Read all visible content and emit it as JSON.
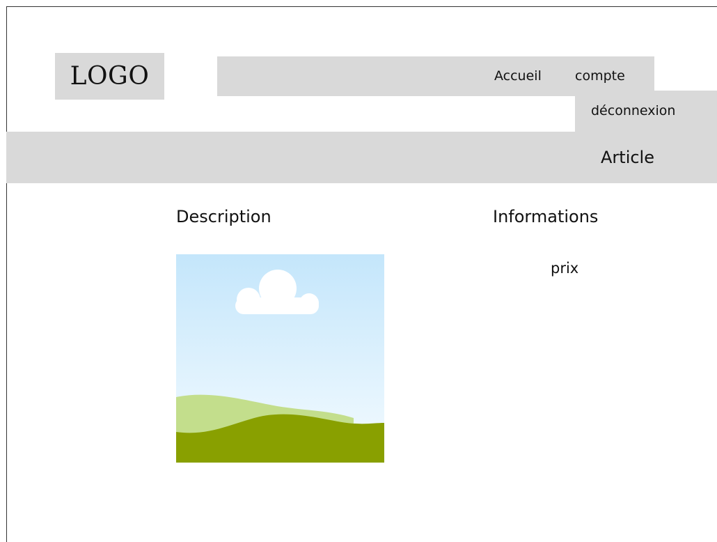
{
  "header": {
    "logo_text": "LOGO",
    "nav": {
      "home_label": "Accueil",
      "account_label": "compte",
      "logout_label": "déconnexion"
    }
  },
  "title_bar": {
    "title": "Article"
  },
  "main": {
    "description_heading": "Description",
    "informations_heading": "Informations",
    "price_label": "prix",
    "image_icon": "image-placeholder-icon"
  },
  "colors": {
    "block_gray": "#d9d9d9",
    "sky_top": "#c4e6fb",
    "grass_light": "#c3de8c",
    "grass_dark": "#89a000"
  }
}
